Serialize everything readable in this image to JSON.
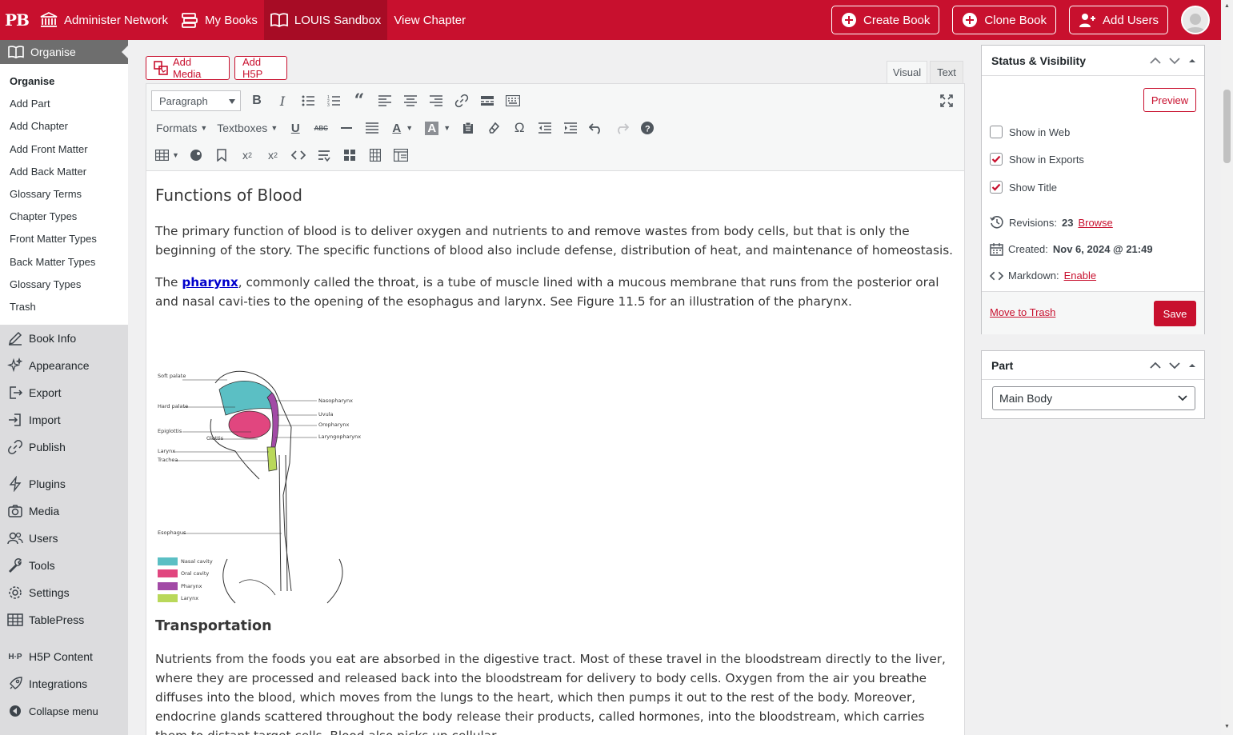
{
  "adminbar": {
    "logo": "PB",
    "items": [
      {
        "label": "Administer Network",
        "icon": "institution-icon"
      },
      {
        "label": "My Books",
        "icon": "books-icon"
      },
      {
        "label": "LOUIS Sandbox",
        "icon": "book-open-icon"
      },
      {
        "label": "View Chapter"
      }
    ],
    "buttons": [
      {
        "label": "Create Book",
        "icon": "plus-circle-icon"
      },
      {
        "label": "Clone Book",
        "icon": "clone-icon"
      },
      {
        "label": "Add Users",
        "icon": "user-plus-icon"
      }
    ]
  },
  "sidebar": {
    "current": "Organise",
    "submenu": [
      "Organise",
      "Add Part",
      "Add Chapter",
      "Add Front Matter",
      "Add Back Matter",
      "Glossary Terms",
      "Chapter Types",
      "Front Matter Types",
      "Back Matter Types",
      "Glossary Types",
      "Trash"
    ],
    "menu": [
      "Book Info",
      "Appearance",
      "Export",
      "Import",
      "Publish",
      "Plugins",
      "Media",
      "Users",
      "Tools",
      "Settings",
      "TablePress",
      "H5P Content",
      "Integrations",
      "Collapse menu"
    ]
  },
  "editor": {
    "add_media": "Add Media",
    "add_h5p": "Add H5P",
    "tab_visual": "Visual",
    "tab_text": "Text",
    "paragraph_select": "Paragraph",
    "formats": "Formats",
    "textboxes": "Textboxes"
  },
  "content": {
    "heading": "Functions of Blood",
    "para1": "The primary function of blood is to deliver oxygen and nutrients to and remove wastes from body cells, but that is only the beginning of the story. The specific functions of blood also include defense, distribution of heat, and maintenance of homeostasis.",
    "para2_pre": "The ",
    "para2_link": "pharynx",
    "para2_post": ", commonly called the throat, is a tube of muscle lined with a mucous membrane that runs from the posterior oral and nasal cavi-ties to the opening of the esophagus and larynx. See Figure 11.5 for an illustration of the pharynx.",
    "figure": {
      "labels_left": [
        "Soft palate",
        "Hard palate",
        "Epiglottis",
        "Glottis",
        "Larynx",
        "Trachea",
        "Esophagus"
      ],
      "labels_right": [
        "Nasopharynx",
        "Uvula",
        "Oropharynx",
        "Laryngopharynx"
      ],
      "legend": [
        {
          "label": "Nasal cavity",
          "color": "#5bbfc4"
        },
        {
          "label": "Oral cavity",
          "color": "#e1467f"
        },
        {
          "label": "Pharynx",
          "color": "#a24aa6"
        },
        {
          "label": "Larynx",
          "color": "#b9d85a"
        }
      ]
    },
    "heading2": "Transportation",
    "para3": "Nutrients from the foods you eat are absorbed in the digestive tract. Most of these travel in the bloodstream directly to the liver, where they are processed and released back into the bloodstream for delivery to body cells. Oxygen from the air you breathe diffuses into the blood, which moves from the lungs to the heart, which then pumps it out to the rest of the body. Moreover, endocrine glands scattered throughout the body release their products, called hormones, into the bloodstream, which carries them to distant target cells. Blood also picks up cellular"
  },
  "status": {
    "title": "Status & Visibility",
    "preview": "Preview",
    "show_web": "Show in Web",
    "show_exports": "Show in Exports",
    "show_title": "Show Title",
    "show_web_checked": false,
    "show_exports_checked": true,
    "show_title_checked": true,
    "revisions_label": "Revisions: ",
    "revisions_count": "23",
    "revisions_link": "Browse",
    "created_label": "Created: ",
    "created_value": "Nov 6, 2024 @ 21:49",
    "markdown_label": "Markdown: ",
    "markdown_link": "Enable",
    "trash": "Move to Trash",
    "save": "Save"
  },
  "part": {
    "title": "Part",
    "selected": "Main Body"
  },
  "colors": {
    "brand": "#c8102e",
    "sidebar_bg": "#dcdcde"
  }
}
